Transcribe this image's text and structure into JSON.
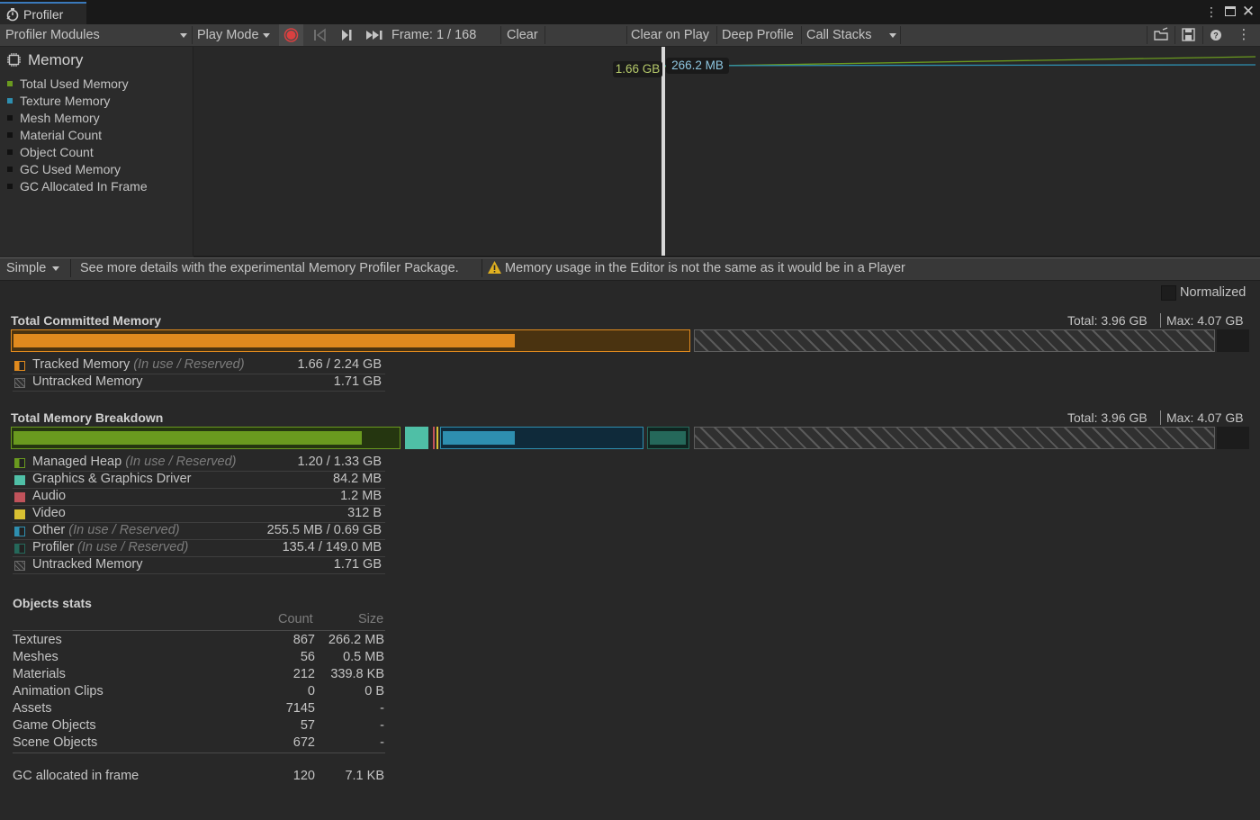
{
  "window": {
    "tab_title": "Profiler"
  },
  "toolbar": {
    "modules_label": "Profiler Modules",
    "play_mode_label": "Play Mode",
    "frame_label": "Frame: 1 / 168",
    "clear_label": "Clear",
    "clear_on_play_label": "Clear on Play",
    "deep_profile_label": "Deep Profile",
    "call_stacks_label": "Call Stacks"
  },
  "module": {
    "title": "Memory",
    "items": [
      {
        "label": "Total Used Memory",
        "color": "#6a9a1f"
      },
      {
        "label": "Texture Memory",
        "color": "#2e8fb0"
      },
      {
        "label": "Mesh Memory",
        "color": "#111111"
      },
      {
        "label": "Material Count",
        "color": "#111111"
      },
      {
        "label": "Object Count",
        "color": "#111111"
      },
      {
        "label": "GC Used Memory",
        "color": "#111111"
      },
      {
        "label": "GC Allocated In Frame",
        "color": "#111111"
      }
    ]
  },
  "graph": {
    "tooltip_total": "1.66 GB",
    "tooltip_texture": "266.2 MB",
    "total_color": "#6a9a1f",
    "texture_color": "#2e8fb0"
  },
  "details_bar": {
    "view_label": "Simple",
    "hint": "See more details with the experimental Memory Profiler Package.",
    "warning": "Memory usage in the Editor is not the same as it would be in a Player",
    "normalized_label": "Normalized"
  },
  "committed": {
    "title": "Total Committed Memory",
    "total_label": "Total: 3.96 GB",
    "max_label": "Max: 4.07 GB",
    "tracked_fraction_of_max": 0.55,
    "tracked_used_fraction": 0.74,
    "rows": [
      {
        "label": "Tracked Memory",
        "note": "(In use / Reserved)",
        "value": "1.66 / 2.24 GB",
        "color": "#e08a1e"
      },
      {
        "label": "Untracked Memory",
        "note": "",
        "value": "1.71 GB",
        "color": "#555555"
      }
    ]
  },
  "breakdown": {
    "title": "Total Memory Breakdown",
    "total_label": "Total: 3.96 GB",
    "max_label": "Max: 4.07 GB",
    "rows": [
      {
        "label": "Managed Heap",
        "note": "(In use / Reserved)",
        "value": "1.20 / 1.33 GB",
        "color": "#6a9a1f"
      },
      {
        "label": "Graphics & Graphics Driver",
        "note": "",
        "value": "84.2 MB",
        "color": "#4fbfa6"
      },
      {
        "label": "Audio",
        "note": "",
        "value": "1.2 MB",
        "color": "#c0535b"
      },
      {
        "label": "Video",
        "note": "",
        "value": "312 B",
        "color": "#d8c032"
      },
      {
        "label": "Other",
        "note": "(In use / Reserved)",
        "value": "255.5 MB / 0.69 GB",
        "color": "#2e8fb0"
      },
      {
        "label": "Profiler",
        "note": "(In use / Reserved)",
        "value": "135.4 / 149.0 MB",
        "color": "#25685a"
      },
      {
        "label": "Untracked Memory",
        "note": "",
        "value": "1.71 GB",
        "color": "#555555"
      }
    ]
  },
  "objects": {
    "title": "Objects stats",
    "col_count": "Count",
    "col_size": "Size",
    "rows": [
      {
        "name": "Textures",
        "count": "867",
        "size": "266.2 MB"
      },
      {
        "name": "Meshes",
        "count": "56",
        "size": "0.5 MB"
      },
      {
        "name": "Materials",
        "count": "212",
        "size": "339.8 KB"
      },
      {
        "name": "Animation Clips",
        "count": "0",
        "size": "0 B"
      },
      {
        "name": "Assets",
        "count": "7145",
        "size": "-"
      },
      {
        "name": "Game Objects",
        "count": "57",
        "size": "-"
      },
      {
        "name": "Scene Objects",
        "count": "672",
        "size": "-"
      }
    ],
    "gc_row": {
      "name": "GC allocated in frame",
      "count": "120",
      "size": "7.1 KB"
    }
  }
}
